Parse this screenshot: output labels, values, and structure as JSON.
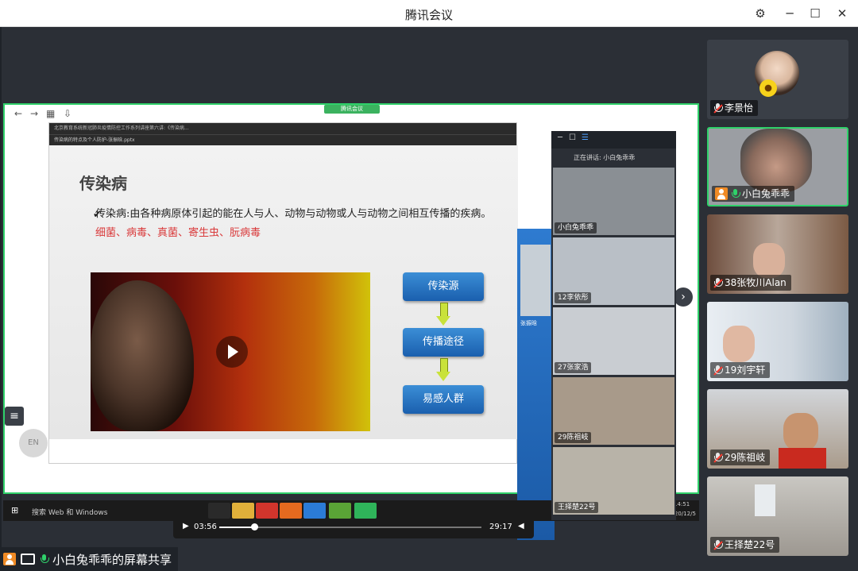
{
  "app": {
    "title": "腾讯会议"
  },
  "window_controls": {
    "settings": "⚙",
    "minimize": "─",
    "maximize": "☐",
    "close": "✕"
  },
  "share": {
    "meeting_pill": "腾讯会议",
    "sharer_label": "小白兔乖乖的屏幕共享",
    "speaking_label": "正在讲话: 小白兔乖乖"
  },
  "ppt": {
    "window_title": "传染病的特点及个人防护-张振晗.pptx",
    "top_caption": "北京教育系统新冠肺炎疫情防控工作系列讲座第六讲:《传染病...",
    "slide_title": "传染病",
    "definition": "传染病:由各种病原体引起的能在人与人、动物与动物或人与动物之间相互传播的疾病。",
    "pathogens": "细菌、病毒、真菌、寄生虫、朊病毒",
    "flow": [
      "传染源",
      "传播途径",
      "易感人群"
    ],
    "side_name": "张振晗"
  },
  "video": {
    "current_time": "03:56",
    "duration": "29:17",
    "progress": 0.134
  },
  "taskbar": {
    "search": "搜索 Web 和 Windows",
    "time": "14:51",
    "date": "2020/12/5"
  },
  "overlay_participants": [
    {
      "name": "小白兔乖乖",
      "color": "#8a8f94"
    },
    {
      "name": "12李依彤",
      "color": "#b9bfc6"
    },
    {
      "name": "27张家浩",
      "color": "#c9cdd2"
    },
    {
      "name": "29陈祖岐",
      "color": "#a89a8a"
    },
    {
      "name": "王择楚22号",
      "color": "#b8b3a8"
    }
  ],
  "participants": [
    {
      "name": "李景怡",
      "mic": "muted",
      "color": "#3a3f47"
    },
    {
      "name": "小白兔乖乖",
      "mic": "active",
      "color": "#9b9ea3"
    },
    {
      "name": "38张牧川Alan",
      "mic": "muted",
      "color": "#8c7b6c"
    },
    {
      "name": "19刘宇轩",
      "mic": "muted",
      "color": "#cfd7df"
    },
    {
      "name": "29陈祖岐",
      "mic": "muted",
      "color": "#b2a696"
    },
    {
      "name": "王择楚22号",
      "mic": "muted",
      "color": "#b7b2aa"
    }
  ]
}
